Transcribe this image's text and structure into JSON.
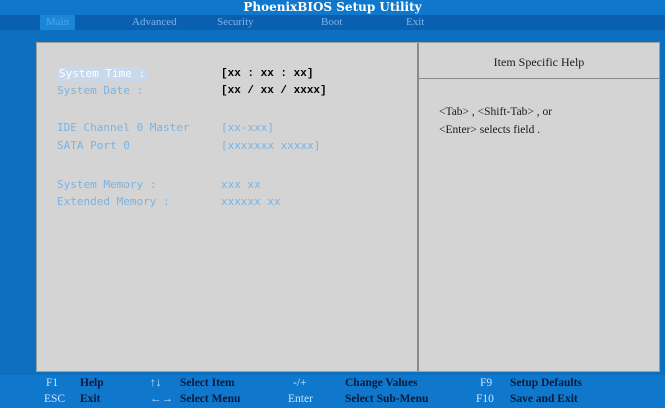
{
  "app": {
    "title": "PhoenixBIOS Setup Utility"
  },
  "menu": [
    {
      "label": "Main",
      "active": true
    },
    {
      "label": "Advanced",
      "active": false
    },
    {
      "label": "Security",
      "active": false
    },
    {
      "label": "Boot",
      "active": false
    },
    {
      "label": "Exit",
      "active": false
    }
  ],
  "fields": {
    "system_time": {
      "label": "System Time :",
      "value": "[xx : xx : xx]"
    },
    "system_date": {
      "label": "System Date :",
      "value": "[xx / xx / xxxx]"
    },
    "ide_channel": {
      "label": "IDE Channel 0 Master",
      "value": "[xx-xxx]"
    },
    "sata_port": {
      "label": "SATA Port 0",
      "value": "[xxxxxxx  xxxxx]"
    },
    "system_memory": {
      "label": "System Memory :",
      "value": "xxx xx"
    },
    "extended_memory": {
      "label": "Extended Memory :",
      "value": "xxxxxx xx"
    }
  },
  "help": {
    "title": "Item Specific Help",
    "line1": "<Tab> , <Shift-Tab> , or",
    "line2": "<Enter> selects field ."
  },
  "status": {
    "f1_key": "F1",
    "f1_desc": "Help",
    "updown_key": "↑↓",
    "updown_desc": "Select Item",
    "plusminus_key": "-/+",
    "plusminus_desc": "Change Values",
    "f9_key": "F9",
    "f9_desc": "Setup Defaults",
    "esc_key": "ESC",
    "esc_desc": "Exit",
    "leftright_key": "←→",
    "leftright_desc": "Select Menu",
    "enter_key": "Enter",
    "enter_desc": "Select Sub-Menu",
    "f10_key": "F10",
    "f10_desc": "Save and Exit"
  }
}
